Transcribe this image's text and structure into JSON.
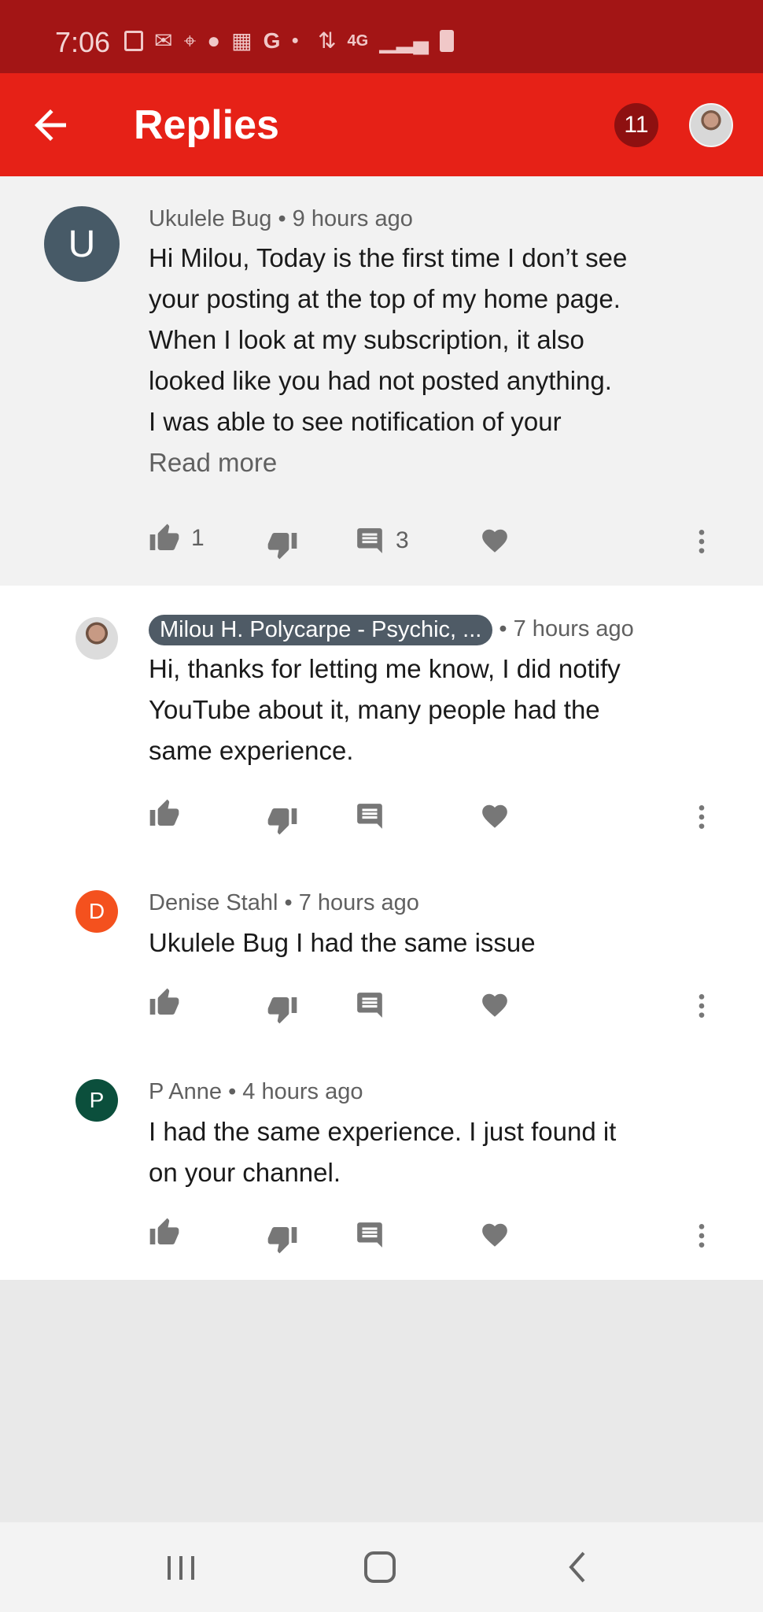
{
  "status": {
    "time": "7:06",
    "icons": [
      "photo-notification-icon",
      "mail-icon",
      "location-icon",
      "location-icon",
      "calendar-icon",
      "google-icon",
      "dot-icon",
      "wifi-icon",
      "4g-lte-icon",
      "signal-icon",
      "battery-icon"
    ],
    "network_label": "4G"
  },
  "app_bar": {
    "title": "Replies",
    "notification_count": "11"
  },
  "parent_comment": {
    "avatar_letter": "U",
    "avatar_color": "#475a67",
    "author": "Ukulele Bug",
    "time": "9 hours ago",
    "lines": [
      "Hi Milou, Today is the first time I don’t see",
      "your posting at the top of my home page.",
      "When I look at my subscription, it also",
      "looked like you had not posted anything.",
      "I was able to see notification of your"
    ],
    "read_more": "Read more",
    "likes": "1",
    "replies": "3"
  },
  "replies": [
    {
      "author": "Milou H. Polycarpe - Psychic, Medium",
      "author_display": "Milou H. Polycarpe - Psychic, ...",
      "time": "7 hours ago",
      "lines": [
        "Hi, thanks for letting me know, I did notify",
        "YouTube about it, many people had the",
        "same experience."
      ]
    },
    {
      "avatar_letter": "D",
      "avatar_color": "#f4511e",
      "author": "Denise Stahl",
      "time": "7 hours ago",
      "lines": [
        "Ukulele Bug I had the same issue"
      ]
    },
    {
      "avatar_letter": "P",
      "avatar_color": "#0b4f3c",
      "author": "P Anne",
      "time": "4 hours ago",
      "lines": [
        "I had the same experience. I just found it",
        "on your channel."
      ]
    }
  ],
  "separator": "•",
  "colors": {
    "status_bar": "#a31515",
    "app_bar": "#e62117",
    "badge": "#8e1010",
    "owner_chip": "#4f5b66",
    "icon_gray": "#777777"
  }
}
